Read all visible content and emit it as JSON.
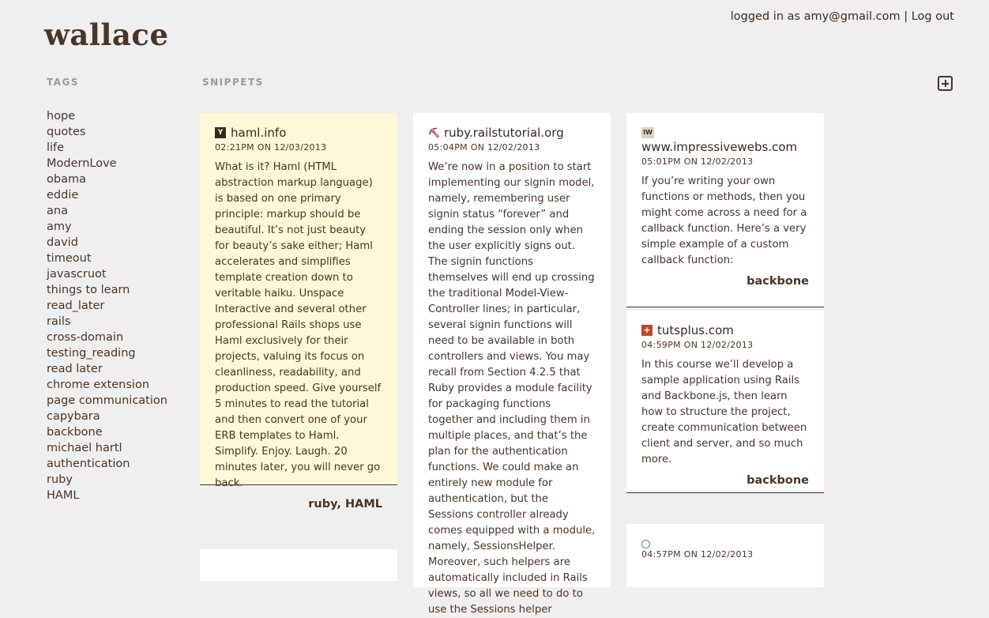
{
  "app": {
    "logo": "wallace"
  },
  "user": {
    "logged_in_prefix": "logged in as",
    "email": "amy@gmail.com",
    "separator": "|",
    "logout_label": "Log out"
  },
  "sections": {
    "tags_label": "TAGS",
    "snippets_label": "SNIPPETS"
  },
  "tags": [
    "hope",
    "quotes",
    "life",
    "ModernLove",
    "obama",
    "eddie",
    "ana",
    "amy",
    "david",
    "timeout",
    "javascruot",
    "things to learn",
    "read_later",
    "rails",
    "cross-domain",
    "testing_reading",
    "read later",
    "chrome extension",
    "page communication",
    "capybara",
    "backbone",
    "michael hartl",
    "authentication",
    "ruby",
    "HAML"
  ],
  "snippets": [
    {
      "site": "haml.info",
      "icon": "y-combinator-icon",
      "icon_color": "#3a2a1e",
      "time": "02:21PM",
      "on": "ON",
      "date": "12/03/2013",
      "body": "What is it? Haml (HTML abstraction markup language) is based on one primary principle: markup should be beautiful. It’s not just beauty for beauty’s sake either; Haml accelerates and simplifies template creation down to veritable haiku. Unspace Interactive and several other professional Rails shops use Haml exclusively for their projects, valuing its focus on cleanliness, readability, and production speed. Give yourself 5 minutes to read the tutorial and then convert one of your ERB templates to Haml. Simplify. Enjoy. Laugh. 20 minutes later, you will never go back.",
      "tags": "ruby, HAML",
      "highlighted": true
    },
    {
      "site": "ruby.railstutorial.org",
      "icon": "railstutorial-icon",
      "icon_color": "#b01a1a",
      "time": "05:04PM",
      "on": "ON",
      "date": "12/02/2013",
      "body": "We’re now in a position to start implementing our signin model, namely, remembering user signin status “forever” and ending the session only when the user explicitly signs out. The signin functions themselves will end up crossing the traditional Model-View-Controller lines; in particular, several signin functions will need to be available in both controllers and views. You may recall from Section 4.2.5 that Ruby provides a module facility for packaging functions together and including them in multiple places, and that’s the plan for the authentication functions. We could make an entirely new module for authentication, but the Sessions controller already comes equipped with a module, namely, SessionsHelper. Moreover, such helpers are automatically included in Rails views, so all we need to do to use the Sessions helper",
      "tags": ""
    },
    {
      "site": "www.impressivewebs.com",
      "icon": "impressivewebs-icon",
      "icon_color": "#d8d2bf",
      "time": "05:01PM",
      "on": "ON",
      "date": "12/02/2013",
      "body": "If you’re writing your own functions or methods, then you might come across a need for a callback function. Here’s a very simple example of a custom callback function:",
      "tags": "backbone"
    },
    {
      "site": "tutsplus.com",
      "icon": "tutsplus-icon",
      "icon_color": "#c0482a",
      "time": "04:59PM",
      "on": "ON",
      "date": "12/02/2013",
      "body": "In this course we’ll develop a sample application using Rails and Backbone.js, then learn how to structure the project, create communication between client and server, and so much more.",
      "tags": "backbone"
    },
    {
      "site": "",
      "icon": "globe-icon",
      "icon_color": "#6a7fb5",
      "time": "04:57PM",
      "on": "ON",
      "date": "12/02/2013",
      "body": "",
      "tags": ""
    }
  ]
}
